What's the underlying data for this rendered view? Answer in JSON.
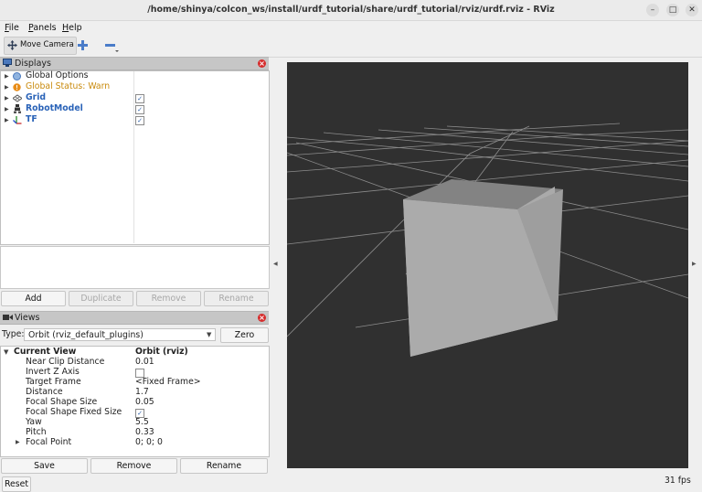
{
  "window": {
    "title": "/home/shinya/colcon_ws/install/urdf_tutorial/share/urdf_tutorial/rviz/urdf.rviz - RViz",
    "controls": {
      "minimize": "–",
      "maximize": "□",
      "close": "✕"
    }
  },
  "menu": {
    "file_u": "F",
    "file_rest": "ile",
    "panels_u": "P",
    "panels_rest": "anels",
    "help_u": "H",
    "help_rest": "elp"
  },
  "toolbar": {
    "move_camera": "Move Camera",
    "tool_icons": [
      "move-camera-icon",
      "add-tool-icon",
      "remove-tool-icon"
    ]
  },
  "displays": {
    "title": "Displays",
    "items": [
      {
        "label": "Global Options",
        "color": "#222222",
        "bold": false,
        "checked": null
      },
      {
        "label": "Global Status: Warn",
        "color": "#c98a0c",
        "bold": false,
        "checked": null
      },
      {
        "label": "Grid",
        "color": "#2a63b8",
        "bold": true,
        "checked": "✓"
      },
      {
        "label": "RobotModel",
        "color": "#2a63b8",
        "bold": true,
        "checked": "✓"
      },
      {
        "label": "TF",
        "color": "#2a63b8",
        "bold": true,
        "checked": "✓"
      }
    ],
    "buttons": {
      "add": "Add",
      "duplicate": "Duplicate",
      "remove": "Remove",
      "rename": "Rename"
    }
  },
  "views": {
    "title": "Views",
    "type_label": "Type:",
    "type_value": "Orbit (rviz_default_plugins)",
    "zero": "Zero",
    "current_view": {
      "label": "Current View",
      "value": "Orbit (rviz)"
    },
    "props": [
      {
        "label": "Near Clip Distance",
        "value": "0.01"
      },
      {
        "label": "Invert Z Axis",
        "value": ""
      },
      {
        "label": "Target Frame",
        "value": "<Fixed Frame>"
      },
      {
        "label": "Distance",
        "value": "1.7"
      },
      {
        "label": "Focal Shape Size",
        "value": "0.05"
      },
      {
        "label": "Focal Shape Fixed Size",
        "value": "✓"
      },
      {
        "label": "Yaw",
        "value": "5.5"
      },
      {
        "label": "Pitch",
        "value": "0.33"
      },
      {
        "label": "Focal Point",
        "value": "0; 0; 0"
      }
    ],
    "buttons": {
      "save": "Save",
      "remove": "Remove",
      "rename": "Rename"
    }
  },
  "status": {
    "reset": "Reset",
    "fps": "31 fps"
  },
  "colors": {
    "render_bg": "#303030",
    "grid": "#8c8c8c",
    "box_front": "#aaaaaa",
    "box_top": "#838383",
    "warn": "#c98a0c",
    "link": "#2a63b8"
  }
}
